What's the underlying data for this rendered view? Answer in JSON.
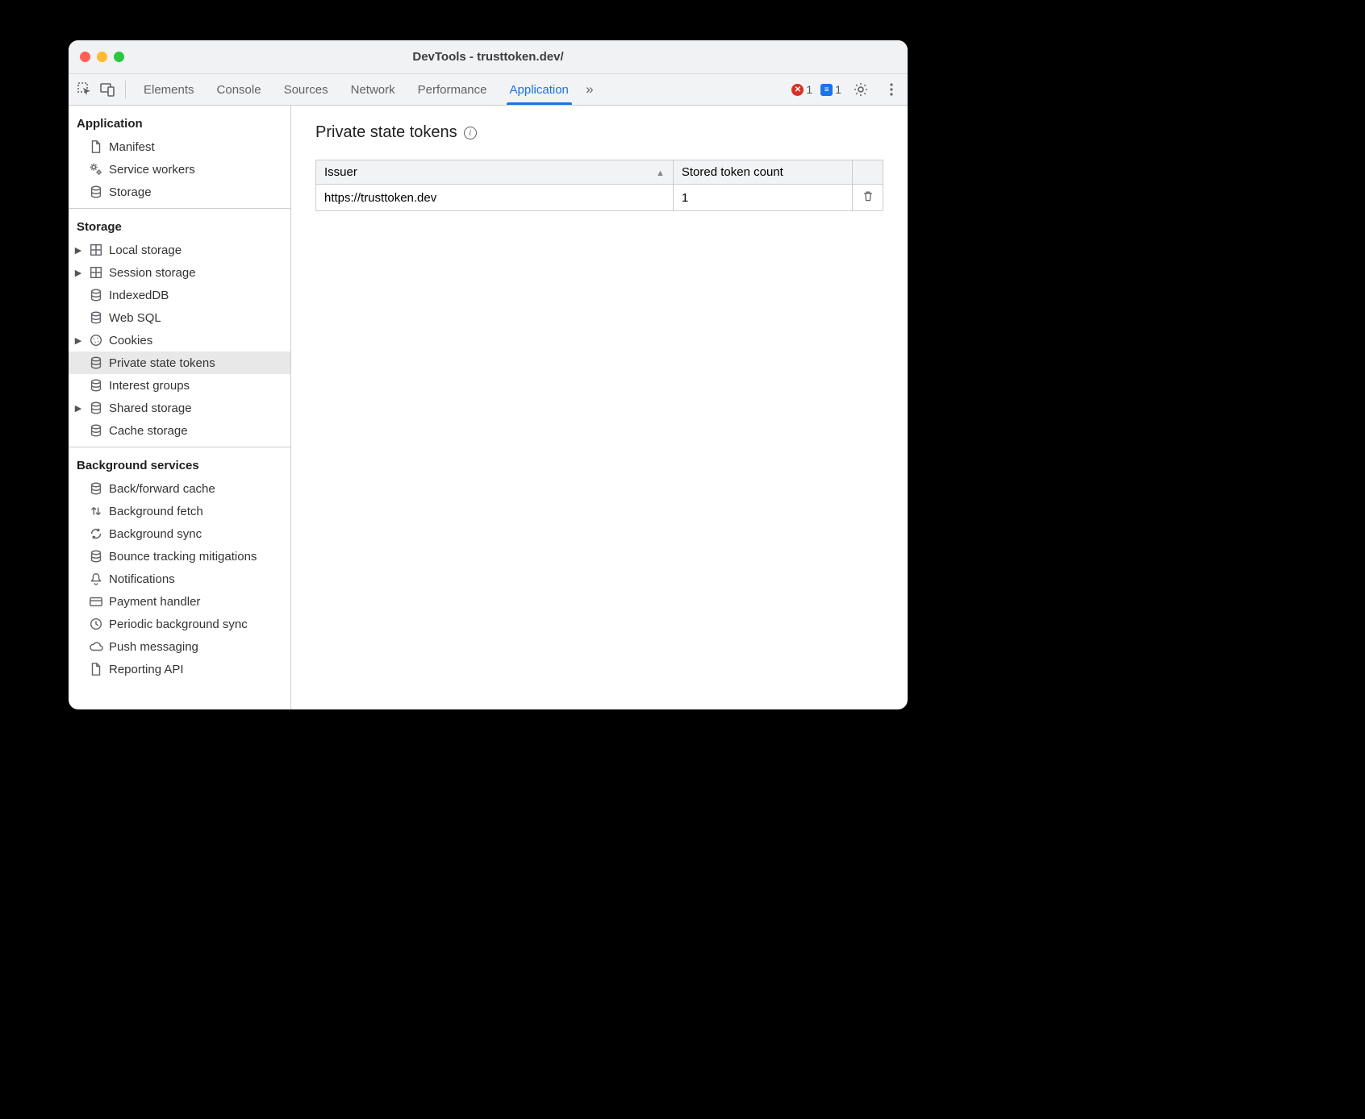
{
  "window": {
    "title": "DevTools - trusttoken.dev/"
  },
  "toolbar": {
    "tabs": [
      "Elements",
      "Console",
      "Sources",
      "Network",
      "Performance",
      "Application"
    ],
    "active_tab_index": 5,
    "error_count": "1",
    "info_count": "1"
  },
  "sidebar": {
    "sections": [
      {
        "title": "Application",
        "items": [
          {
            "label": "Manifest",
            "icon": "doc",
            "expander": "none"
          },
          {
            "label": "Service workers",
            "icon": "gears",
            "expander": "none"
          },
          {
            "label": "Storage",
            "icon": "db",
            "expander": "none"
          }
        ]
      },
      {
        "title": "Storage",
        "items": [
          {
            "label": "Local storage",
            "icon": "grid",
            "expander": "closed"
          },
          {
            "label": "Session storage",
            "icon": "grid",
            "expander": "closed"
          },
          {
            "label": "IndexedDB",
            "icon": "db",
            "expander": "none"
          },
          {
            "label": "Web SQL",
            "icon": "db",
            "expander": "none"
          },
          {
            "label": "Cookies",
            "icon": "cookie",
            "expander": "closed"
          },
          {
            "label": "Private state tokens",
            "icon": "db",
            "expander": "none",
            "selected": true
          },
          {
            "label": "Interest groups",
            "icon": "db",
            "expander": "none"
          },
          {
            "label": "Shared storage",
            "icon": "db",
            "expander": "closed"
          },
          {
            "label": "Cache storage",
            "icon": "db",
            "expander": "none"
          }
        ]
      },
      {
        "title": "Background services",
        "items": [
          {
            "label": "Back/forward cache",
            "icon": "db",
            "expander": "none"
          },
          {
            "label": "Background fetch",
            "icon": "updown",
            "expander": "none"
          },
          {
            "label": "Background sync",
            "icon": "sync",
            "expander": "none"
          },
          {
            "label": "Bounce tracking mitigations",
            "icon": "db",
            "expander": "none"
          },
          {
            "label": "Notifications",
            "icon": "bell",
            "expander": "none"
          },
          {
            "label": "Payment handler",
            "icon": "card",
            "expander": "none"
          },
          {
            "label": "Periodic background sync",
            "icon": "clock",
            "expander": "none"
          },
          {
            "label": "Push messaging",
            "icon": "cloud",
            "expander": "none"
          },
          {
            "label": "Reporting API",
            "icon": "doc",
            "expander": "none"
          }
        ]
      }
    ]
  },
  "panel": {
    "heading": "Private state tokens",
    "columns": [
      "Issuer",
      "Stored token count"
    ],
    "rows": [
      {
        "issuer": "https://trusttoken.dev",
        "count": "1"
      }
    ]
  }
}
